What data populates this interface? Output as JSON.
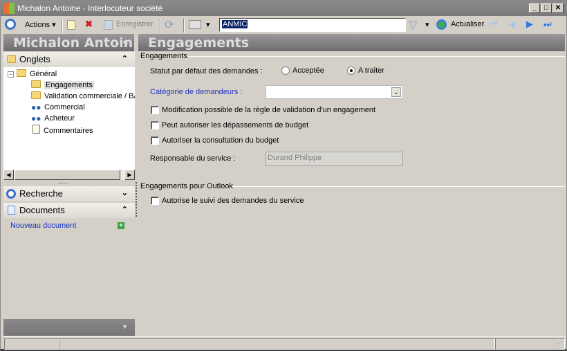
{
  "window": {
    "title": "Michalon Antoine -  Interlocuteur société",
    "minimize": "_",
    "maximize": "□",
    "close": "✕"
  },
  "toolbar": {
    "actions": "Actions",
    "save": "Enregistrer",
    "search_value": "ANMIC",
    "refresh": "Actualiser"
  },
  "left_header": "Michalon Antoin",
  "right_header": "Engagements",
  "sidebar": {
    "onglets": "Onglets",
    "tree": {
      "root": "Général",
      "items": [
        "Engagements",
        "Validation commerciale / BA",
        "Commercial",
        "Acheteur",
        "Commentaires"
      ]
    },
    "recherche": "Recherche",
    "documents": "Documents",
    "new_document": "Nouveau document"
  },
  "form": {
    "group1": "Engagements",
    "statut_label": "Statut par défaut des demandes :",
    "statut_options": [
      "Acceptée",
      "A traiter"
    ],
    "statut_selected": "A traiter",
    "categorie_label": "Catégorie de demandeurs :",
    "categorie_value": "",
    "checks": [
      {
        "label": "Modification possible de la règle de validation d'un engagement",
        "checked": false
      },
      {
        "label": "Peut autoriser les dépassements de budget",
        "checked": false
      },
      {
        "label": "Autoriser la consultation du budget",
        "checked": false
      }
    ],
    "responsable_label": "Responsable du service :",
    "responsable_value": "Durand Philippe",
    "group2": "Engagements pour Outlook",
    "outlook_check": {
      "label": "Autorise le suivi des demandes du service",
      "checked": false
    }
  }
}
